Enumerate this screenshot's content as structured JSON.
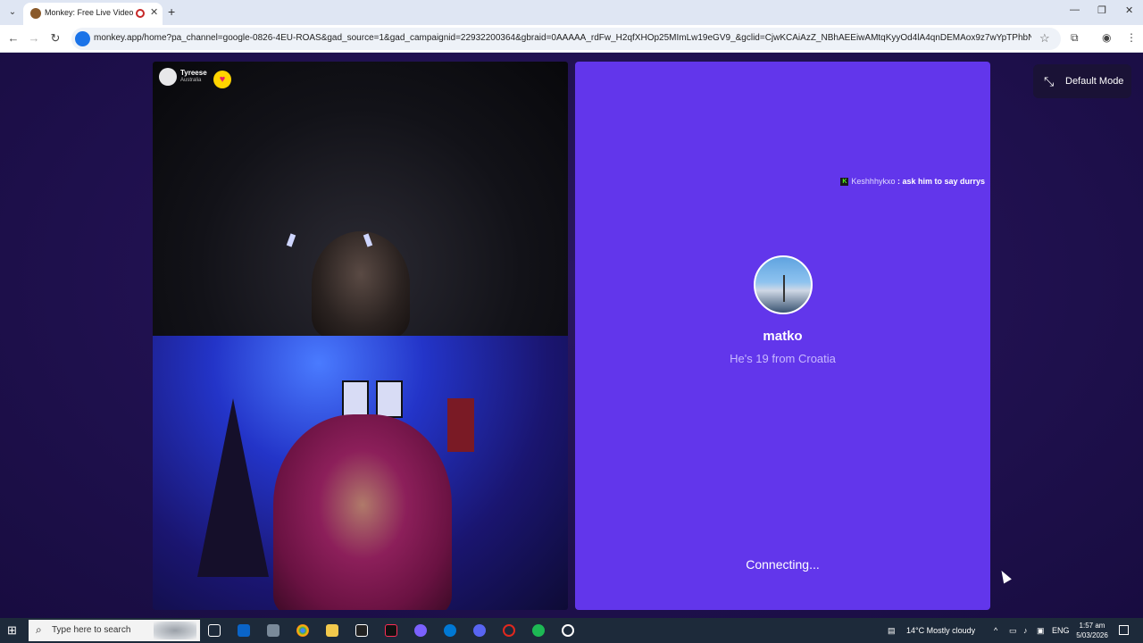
{
  "browser": {
    "tab_title": "Monkey: Free Live Video Ch",
    "url": "monkey.app/home?pa_channel=google-0826-4EU-ROAS&gad_source=1&gad_campaignid=22932200364&gbraid=0AAAAA_rdFw_H2qfXHOp25MImLw19eGV9_&gclid=CjwKCAiAzZ_NBhAEEiwAMtqKyyOd4lA4qnDEMAox9z7wYpTPhbNFEbkxlWzZPM9b49...",
    "icons": [
      "tab-list-icon",
      "favicon",
      "recording-icon",
      "close-icon",
      "plus-icon",
      "back-icon",
      "forward-icon",
      "reload-icon",
      "site-info-icon",
      "star-icon",
      "extensions-icon",
      "profile-icon",
      "menu-icon",
      "minimize-icon",
      "restore-icon",
      "window-close-icon"
    ]
  },
  "video_top": {
    "username": "Tyreese",
    "country": "Australia",
    "heart": "♥"
  },
  "match": {
    "chat_user": "Keshhhykxo",
    "chat_message": " : ask him to say durrys",
    "name": "matko",
    "subtitle": "He's 19 from Croatia",
    "status": "Connecting..."
  },
  "mode_button": {
    "label": "Default Mode"
  },
  "taskbar": {
    "search_placeholder": "Type here to search",
    "weather": "14°C  Mostly cloudy",
    "language": "ENG",
    "time": "1:57 am",
    "date": "5/03/2026"
  },
  "colors": {
    "panel": "#6236eb",
    "background": "#1e1050",
    "heart": "#ffd400"
  }
}
